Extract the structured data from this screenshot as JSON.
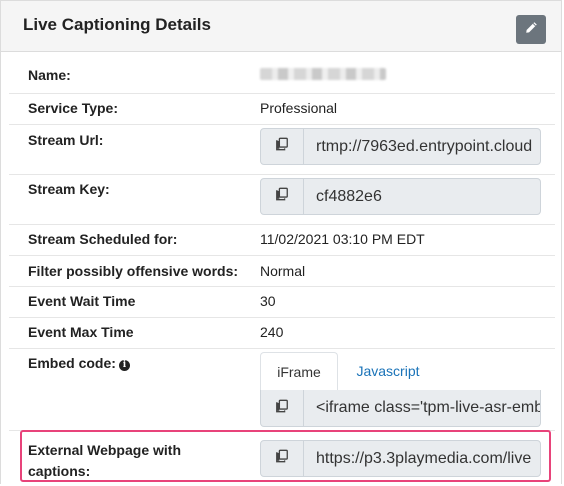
{
  "panel": {
    "title": "Live Captioning Details",
    "edit_icon": "pencil-icon"
  },
  "fields": {
    "name_label": "Name:",
    "service_type_label": "Service Type:",
    "service_type_value": "Professional",
    "stream_url_label": "Stream Url:",
    "stream_url_value": "rtmp://7963ed.entrypoint.cloud",
    "stream_key_label": "Stream Key:",
    "stream_key_value": "cf4882e6",
    "scheduled_label": "Stream Scheduled for:",
    "scheduled_value": "11/02/2021 03:10 PM EDT",
    "filter_label": "Filter possibly offensive words:",
    "filter_value": "Normal",
    "wait_label": "Event Wait Time",
    "wait_value": "30",
    "max_label": "Event Max Time",
    "max_value": "240",
    "embed_label": "Embed code:",
    "embed_info_icon": "info-icon",
    "embed_tabs": [
      "iFrame",
      "Javascript"
    ],
    "embed_active_tab": "iFrame",
    "embed_value": "<iframe class='tpm-live-asr-embed'",
    "external_label_line1": "External Webpage with",
    "external_label_line2": "captions:",
    "external_value": "https://p3.3playmedia.com/live",
    "copy_icon": "copy-icon"
  },
  "colors": {
    "highlight": "#e8437a",
    "link": "#1a73b8",
    "edit_button": "#6c757d"
  }
}
